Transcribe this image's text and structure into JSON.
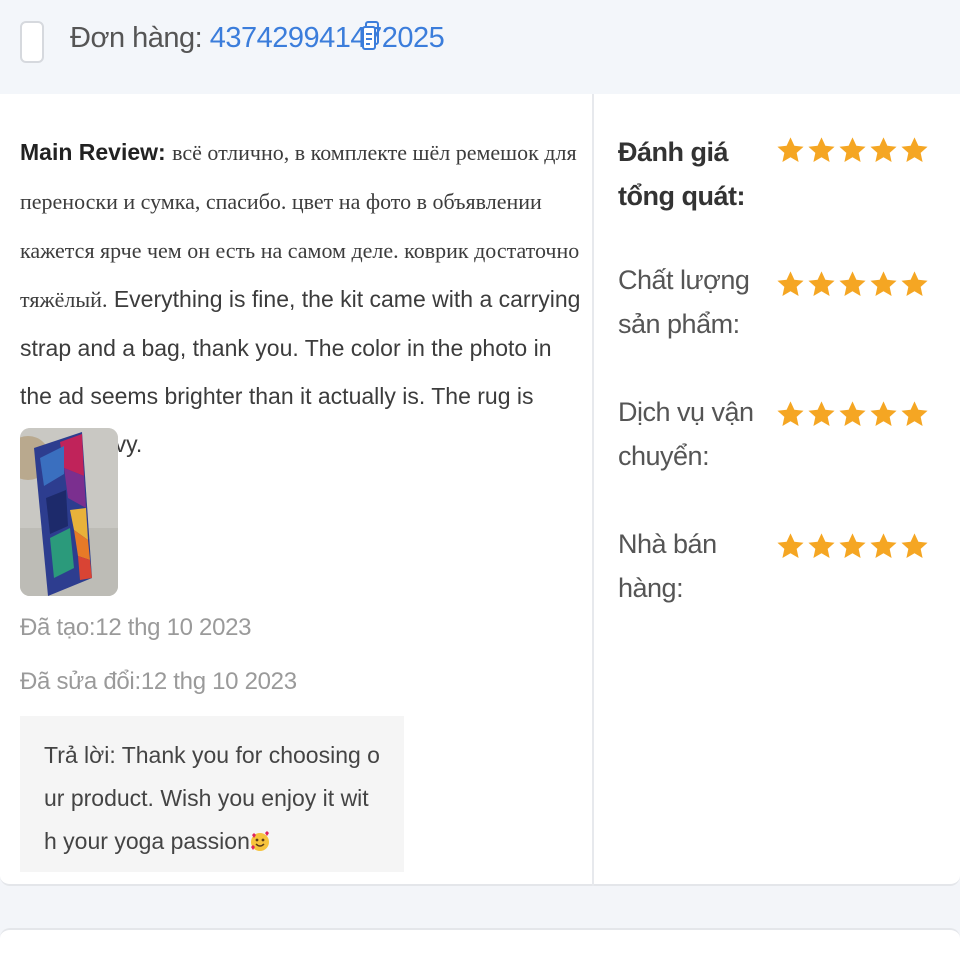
{
  "header": {
    "order_prefix": "Đơn hàng:",
    "order_id": "437429941472025",
    "copy_icon": "copy-icon"
  },
  "review": {
    "label": "Main Review:",
    "text_ru": "всё отлично, в комплекте шёл ремешок для переноски и сумка, спасибо. цвет на фото в объявлении кажется ярче чем он есть на самом деле. коврик достаточно тяжёлый.",
    "text_en": "Everything is fine, the kit came with a carrying strap and a bag, thank you. The color in the photo in the ad seems brighter than it actually is. The rug is quite heavy.",
    "created": "Đã tạo:12 thg 10 2023",
    "modified": "Đã sửa đổi:12 thg 10 2023",
    "reply": "Trả lời: Thank you for choosing our product. Wish you enjoy it with your yoga passion",
    "reply_emoji": "smiling-face-with-hearts-emoji"
  },
  "ratings": [
    {
      "label": "Đánh giá tổng quát:",
      "stars": 5,
      "max": 5
    },
    {
      "label": "Chất lượng sản phẩm:",
      "stars": 5,
      "max": 5
    },
    {
      "label": "Dịch vụ vận chuyển:",
      "stars": 5,
      "max": 5
    },
    {
      "label": "Nhà bán hàng:",
      "stars": 5,
      "max": 5
    }
  ],
  "colors": {
    "accent_link": "#3b7ddb",
    "star": "#f5a623",
    "muted_text": "#9a9a9a"
  }
}
